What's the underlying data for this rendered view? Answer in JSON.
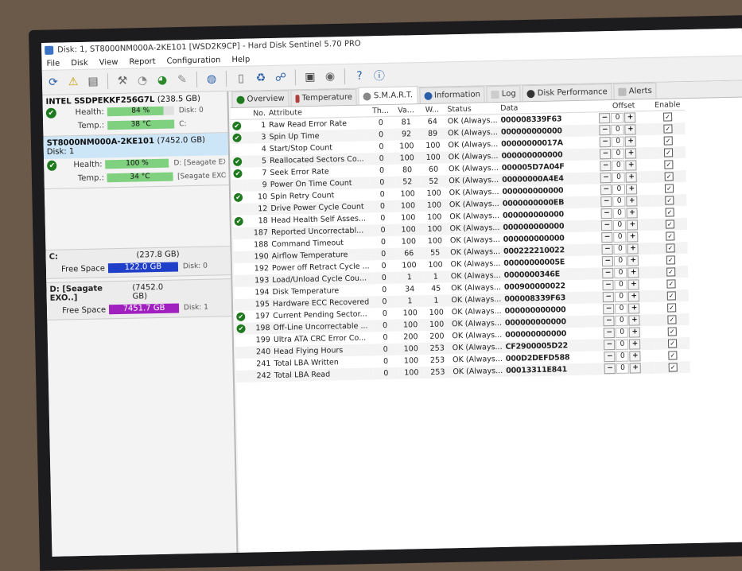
{
  "window": {
    "title": "Disk: 1, ST8000NM000A-2KE101 [WSD2K9CP] - Hard Disk Sentinel 5.70 PRO"
  },
  "menu": [
    "File",
    "Disk",
    "View",
    "Report",
    "Configuration",
    "Help"
  ],
  "disks": [
    {
      "name": "INTEL SSDPEKKF256G7L",
      "size": "(238.5 GB)",
      "health": "84 %",
      "health_pct": 84,
      "health_after": "Disk: 0",
      "temp": "38 °C",
      "temp_after": "C:"
    },
    {
      "name": "ST8000NM000A-2KE101",
      "size": "(7452.0 GB)",
      "size_after": "Disk: 1",
      "health": "100 %",
      "health_pct": 100,
      "health_after": "D: [Seagate EX",
      "temp": "34 °C",
      "temp_after": "[Seagate EXO"
    }
  ],
  "labels": {
    "health": "Health:",
    "temp": "Temp.:",
    "free_space": "Free Space"
  },
  "volumes": [
    {
      "name": "C:",
      "size": "(237.8 GB)",
      "free": "122.0 GB",
      "disk": "Disk: 0"
    },
    {
      "name": "D: [Seagate EXO..]",
      "size": "(7452.0 GB)",
      "free": "7451.7 GB",
      "disk": "Disk: 1"
    }
  ],
  "tabs": [
    "Overview",
    "Temperature",
    "S.M.A.R.T.",
    "Information",
    "Log",
    "Disk Performance",
    "Alerts"
  ],
  "columns": [
    "No.",
    "Attribute",
    "Th...",
    "Va...",
    "W...",
    "Status",
    "Data",
    "Offset",
    "Enable"
  ],
  "smart": [
    {
      "icon": true,
      "no": "1",
      "attr": "Raw Read Error Rate",
      "th": "0",
      "val": "81",
      "w": "64",
      "status": "OK (Always...",
      "data": "000008339F63"
    },
    {
      "icon": true,
      "no": "3",
      "attr": "Spin Up Time",
      "th": "0",
      "val": "92",
      "w": "89",
      "status": "OK (Always...",
      "data": "000000000000"
    },
    {
      "icon": false,
      "no": "4",
      "attr": "Start/Stop Count",
      "th": "0",
      "val": "100",
      "w": "100",
      "status": "OK (Always...",
      "data": "00000000017A"
    },
    {
      "icon": true,
      "no": "5",
      "attr": "Reallocated Sectors Co...",
      "th": "0",
      "val": "100",
      "w": "100",
      "status": "OK (Always...",
      "data": "000000000000"
    },
    {
      "icon": true,
      "no": "7",
      "attr": "Seek Error Rate",
      "th": "0",
      "val": "80",
      "w": "60",
      "status": "OK (Always...",
      "data": "000005D7A04F"
    },
    {
      "icon": false,
      "no": "9",
      "attr": "Power On Time Count",
      "th": "0",
      "val": "52",
      "w": "52",
      "status": "OK (Always...",
      "data": "00000000A4E4"
    },
    {
      "icon": true,
      "no": "10",
      "attr": "Spin Retry Count",
      "th": "0",
      "val": "100",
      "w": "100",
      "status": "OK (Always...",
      "data": "000000000000"
    },
    {
      "icon": false,
      "no": "12",
      "attr": "Drive Power Cycle Count",
      "th": "0",
      "val": "100",
      "w": "100",
      "status": "OK (Always...",
      "data": "0000000000EB"
    },
    {
      "icon": true,
      "no": "18",
      "attr": "Head Health Self Asses...",
      "th": "0",
      "val": "100",
      "w": "100",
      "status": "OK (Always...",
      "data": "000000000000"
    },
    {
      "icon": false,
      "no": "187",
      "attr": "Reported Uncorrectabl...",
      "th": "0",
      "val": "100",
      "w": "100",
      "status": "OK (Always...",
      "data": "000000000000"
    },
    {
      "icon": false,
      "no": "188",
      "attr": "Command Timeout",
      "th": "0",
      "val": "100",
      "w": "100",
      "status": "OK (Always...",
      "data": "000000000000"
    },
    {
      "icon": false,
      "no": "190",
      "attr": "Airflow Temperature",
      "th": "0",
      "val": "66",
      "w": "55",
      "status": "OK (Always...",
      "data": "000222210022"
    },
    {
      "icon": false,
      "no": "192",
      "attr": "Power off Retract Cycle ...",
      "th": "0",
      "val": "100",
      "w": "100",
      "status": "OK (Always...",
      "data": "00000000005E"
    },
    {
      "icon": false,
      "no": "193",
      "attr": "Load/Unload Cycle Cou...",
      "th": "0",
      "val": "1",
      "w": "1",
      "status": "OK (Always...",
      "data": "0000000346E"
    },
    {
      "icon": false,
      "no": "194",
      "attr": "Disk Temperature",
      "th": "0",
      "val": "34",
      "w": "45",
      "status": "OK (Always...",
      "data": "000900000022"
    },
    {
      "icon": false,
      "no": "195",
      "attr": "Hardware ECC Recovered",
      "th": "0",
      "val": "1",
      "w": "1",
      "status": "OK (Always...",
      "data": "000008339F63"
    },
    {
      "icon": true,
      "no": "197",
      "attr": "Current Pending Sector...",
      "th": "0",
      "val": "100",
      "w": "100",
      "status": "OK (Always...",
      "data": "000000000000"
    },
    {
      "icon": true,
      "no": "198",
      "attr": "Off-Line Uncorrectable ...",
      "th": "0",
      "val": "100",
      "w": "100",
      "status": "OK (Always...",
      "data": "000000000000"
    },
    {
      "icon": false,
      "no": "199",
      "attr": "Ultra ATA CRC Error Co...",
      "th": "0",
      "val": "200",
      "w": "200",
      "status": "OK (Always...",
      "data": "000000000000"
    },
    {
      "icon": false,
      "no": "240",
      "attr": "Head Flying Hours",
      "th": "0",
      "val": "100",
      "w": "253",
      "status": "OK (Always...",
      "data": "CF2900005D22"
    },
    {
      "icon": false,
      "no": "241",
      "attr": "Total LBA Written",
      "th": "0",
      "val": "100",
      "w": "253",
      "status": "OK (Always...",
      "data": "000D2DEFD588"
    },
    {
      "icon": false,
      "no": "242",
      "attr": "Total LBA Read",
      "th": "0",
      "val": "100",
      "w": "253",
      "status": "OK (Always...",
      "data": "00013311E841"
    }
  ],
  "offset_value": "0",
  "colors": {
    "health_bar": "#7fd07f",
    "free_c": "#1f3fc8",
    "free_d": "#a020c0",
    "ok_icon": "#1f7a1f"
  }
}
